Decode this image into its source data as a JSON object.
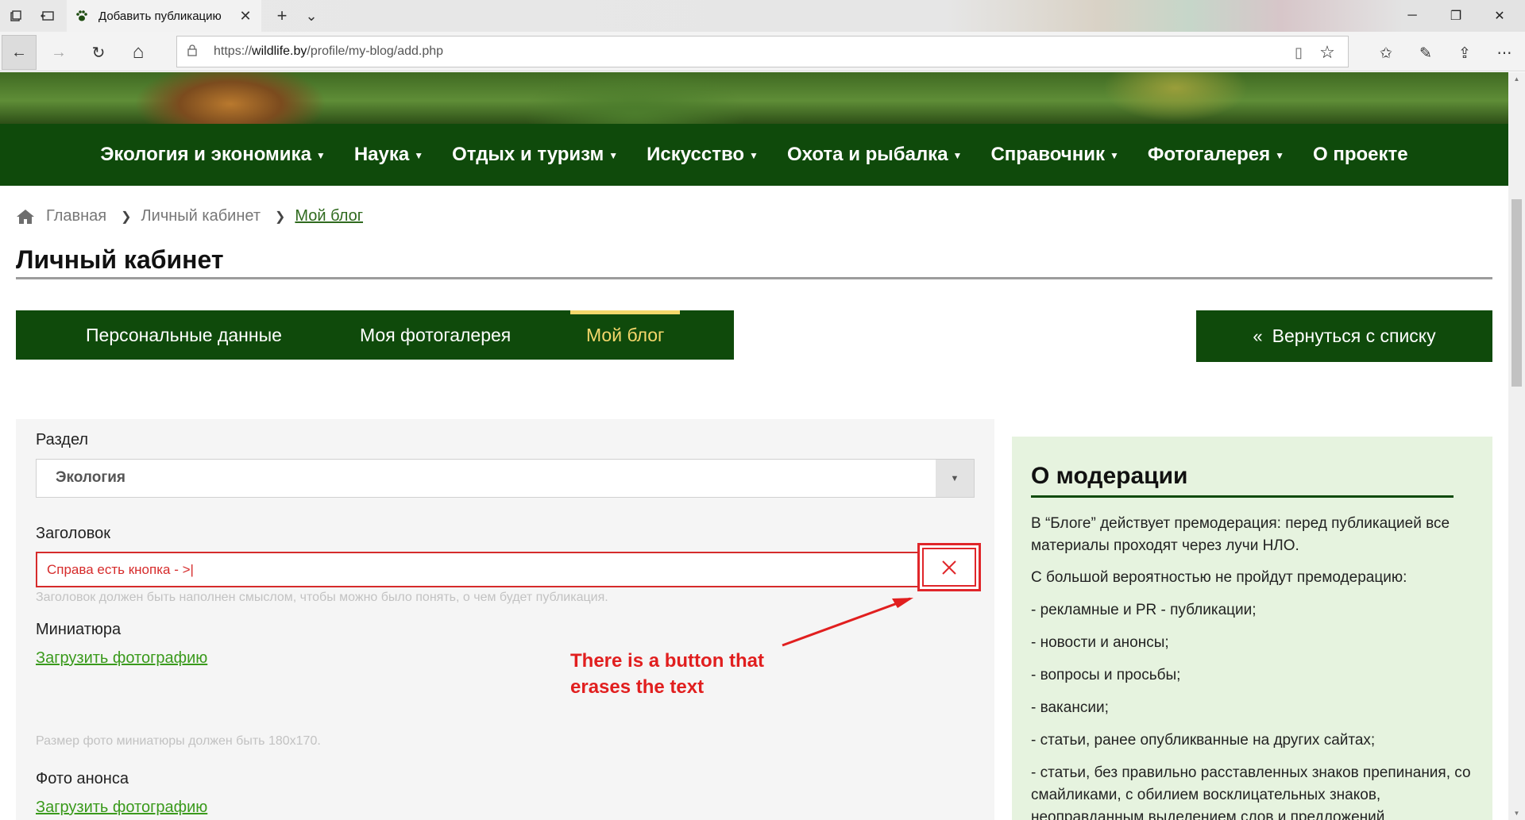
{
  "browser": {
    "tab_title": "Добавить публикацию",
    "url_prefix": "https://",
    "url_host": "wildlife.by",
    "url_path": "/profile/my-blog/add.php",
    "icons": {
      "tab_actions": "tab-actions-icon",
      "tab_preview": "tab-preview-icon",
      "new_tab": "+",
      "tab_list": "⌄",
      "minimize": "─",
      "restore": "❐",
      "close": "✕",
      "back": "←",
      "forward": "→",
      "refresh": "↻",
      "home": "⌂",
      "reading_view": "▯",
      "favorite": "☆",
      "favorites_list": "✩",
      "notes": "✎",
      "share": "⇪",
      "more": "⋯"
    }
  },
  "nav": {
    "items": [
      {
        "label": "Экология и экономика",
        "dropdown": true
      },
      {
        "label": "Наука",
        "dropdown": true
      },
      {
        "label": "Отдых и туризм",
        "dropdown": true
      },
      {
        "label": "Искусство",
        "dropdown": true
      },
      {
        "label": "Охота и рыбалка",
        "dropdown": true
      },
      {
        "label": "Справочник",
        "dropdown": true
      },
      {
        "label": "Фотогалерея",
        "dropdown": true
      },
      {
        "label": "О проекте",
        "dropdown": false
      }
    ]
  },
  "breadcrumb": {
    "home": "Главная",
    "cabinet": "Личный кабинет",
    "current": "Мой блог"
  },
  "page_title": "Личный кабинет",
  "tabs": {
    "personal": "Персональные данные",
    "gallery": "Моя фотогалерея",
    "blog": "Мой блог"
  },
  "back_button": "Вернуться с списку",
  "form": {
    "section_label": "Раздел",
    "section_value": "Экология",
    "title_label": "Заголовок",
    "title_value": "Справа есть кнопка - >|",
    "title_hint": "Заголовок должен быть наполнен смыслом, чтобы можно было понять, о чем будет публикация.",
    "thumb_label": "Миниатюра",
    "thumb_upload": "Загрузить фотографию",
    "thumb_hint": "Размер фото миниатюры должен быть 180x170.",
    "preview_label": "Фото анонса",
    "preview_upload": "Загрузить фотографию"
  },
  "annotation": {
    "line1": "There is a button that",
    "line2": "erases the text",
    "color": "#e11f1f"
  },
  "sidebar": {
    "title": "О модерации",
    "p1": "В “Блоге” действует премодерация: перед публикацией все материалы проходят через лучи НЛО.",
    "p2": "С большой вероятностью не пройдут премодерацию:",
    "p3": "- рекламные и PR - публикации;",
    "p4": "- новости и анонсы;",
    "p5": "- вопросы и просьбы;",
    "p6": "- вакансии;",
    "p7": "- статьи, ранее опубликванные на других сайтах;",
    "p8": "- статьи, без правильно расставленных знаков препинания, со смайликами, с обилием восклицательных знаков, неоправданным выделением слов и предложений"
  },
  "colors": {
    "brand_green": "#0f4a0b",
    "accent_yellow": "#f4d76b",
    "link_green": "#3a9a1c",
    "error_red": "#d62b2b",
    "sidebar_bg": "#e6f3df"
  }
}
